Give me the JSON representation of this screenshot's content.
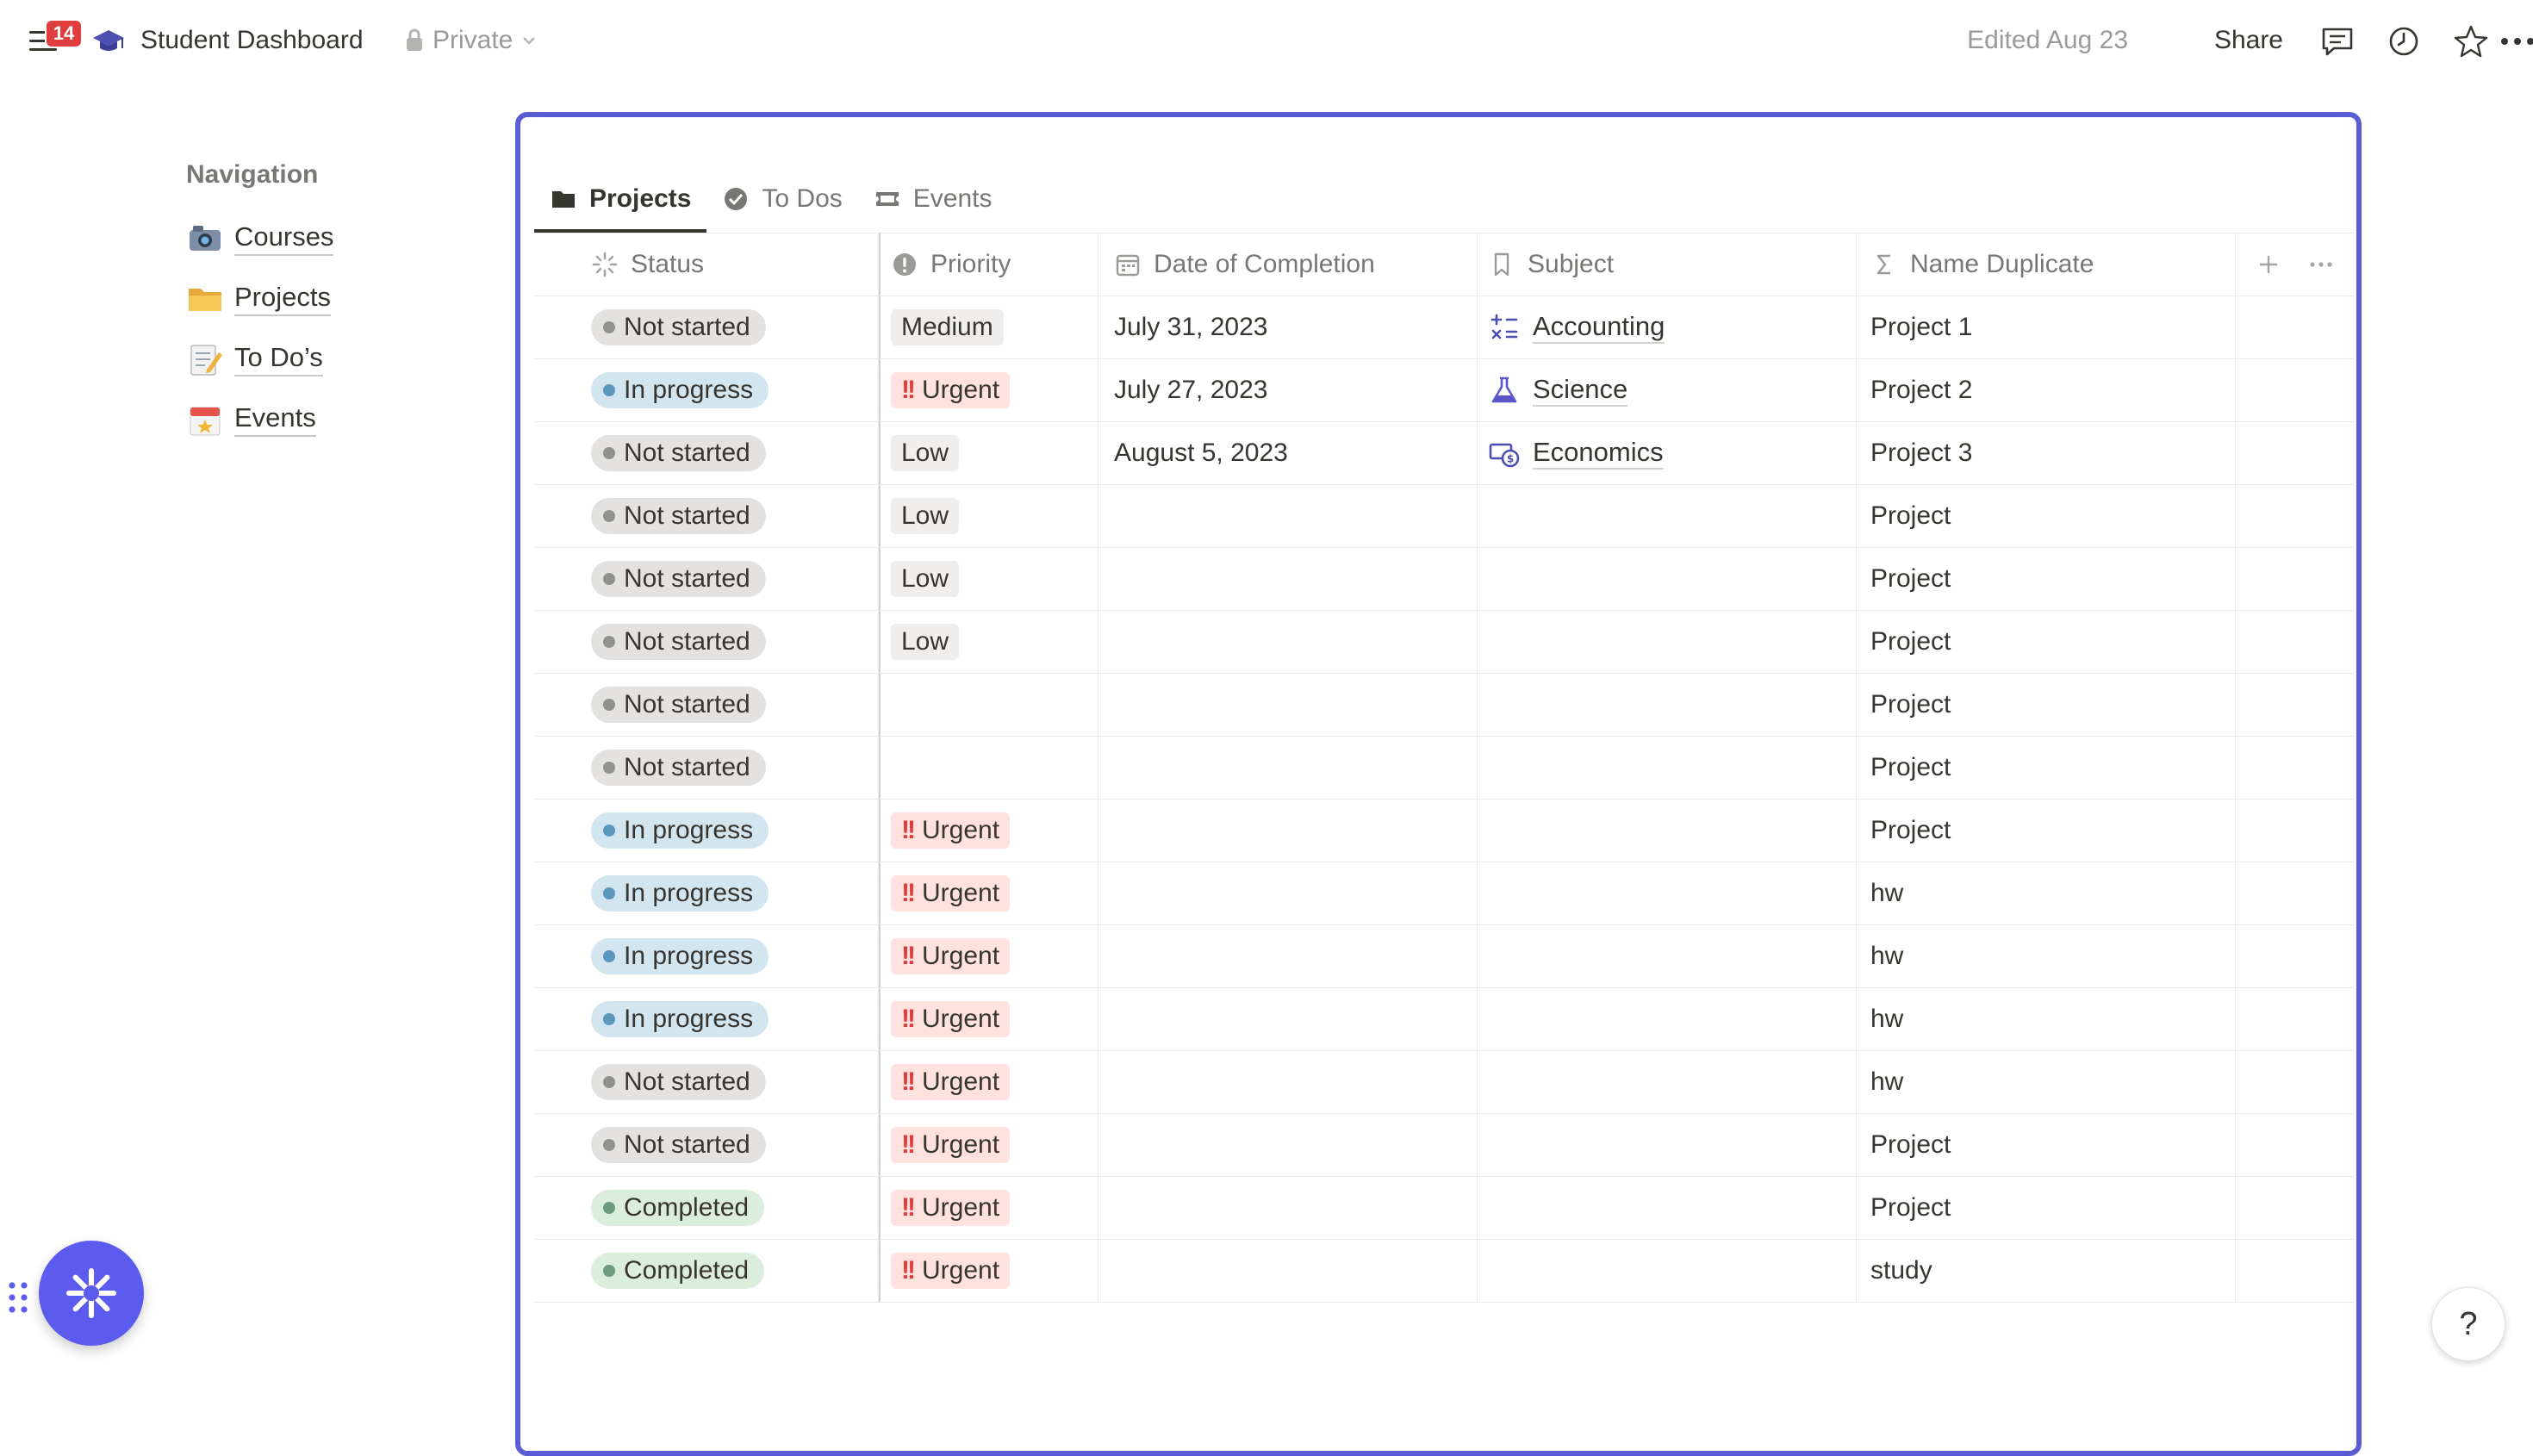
{
  "topbar": {
    "notification_count": "14",
    "title": "Student Dashboard",
    "privacy": "Private",
    "edited": "Edited Aug 23",
    "share": "Share"
  },
  "nav": {
    "heading": "Navigation",
    "items": [
      {
        "label": "Courses",
        "icon": "camera-emoji-icon"
      },
      {
        "label": "Projects",
        "icon": "folder-emoji-icon"
      },
      {
        "label": "To Do’s",
        "icon": "memo-emoji-icon"
      },
      {
        "label": "Events",
        "icon": "calendar-emoji-icon"
      }
    ]
  },
  "tabs": [
    {
      "label": "Projects",
      "icon": "folder-icon",
      "active": true
    },
    {
      "label": "To Dos",
      "icon": "check-circle-icon",
      "active": false
    },
    {
      "label": "Events",
      "icon": "ticket-icon",
      "active": false
    }
  ],
  "columns": {
    "status": "Status",
    "priority": "Priority",
    "date": "Date of Completion",
    "subject": "Subject",
    "name": "Name Duplicate"
  },
  "rows": [
    {
      "status": "Not started",
      "priority": "Medium",
      "date": "July 31, 2023",
      "subject": "Accounting",
      "name": "Project 1"
    },
    {
      "status": "In progress",
      "priority": "Urgent",
      "date": "July 27, 2023",
      "subject": "Science",
      "name": "Project 2"
    },
    {
      "status": "Not started",
      "priority": "Low",
      "date": "August 5, 2023",
      "subject": "Economics",
      "name": "Project 3"
    },
    {
      "status": "Not started",
      "priority": "Low",
      "date": "",
      "subject": "",
      "name": "Project"
    },
    {
      "status": "Not started",
      "priority": "Low",
      "date": "",
      "subject": "",
      "name": "Project"
    },
    {
      "status": "Not started",
      "priority": "Low",
      "date": "",
      "subject": "",
      "name": "Project"
    },
    {
      "status": "Not started",
      "priority": "",
      "date": "",
      "subject": "",
      "name": "Project"
    },
    {
      "status": "Not started",
      "priority": "",
      "date": "",
      "subject": "",
      "name": "Project"
    },
    {
      "status": "In progress",
      "priority": "Urgent",
      "date": "",
      "subject": "",
      "name": "Project"
    },
    {
      "status": "In progress",
      "priority": "Urgent",
      "date": "",
      "subject": "",
      "name": "hw"
    },
    {
      "status": "In progress",
      "priority": "Urgent",
      "date": "",
      "subject": "",
      "name": "hw"
    },
    {
      "status": "In progress",
      "priority": "Urgent",
      "date": "",
      "subject": "",
      "name": "hw"
    },
    {
      "status": "Not started",
      "priority": "Urgent",
      "date": "",
      "subject": "",
      "name": "hw"
    },
    {
      "status": "Not started",
      "priority": "Urgent",
      "date": "",
      "subject": "",
      "name": "Project"
    },
    {
      "status": "Completed",
      "priority": "Urgent",
      "date": "",
      "subject": "",
      "name": "Project"
    },
    {
      "status": "Completed",
      "priority": "Urgent",
      "date": "",
      "subject": "",
      "name": "study"
    }
  ],
  "help": "?",
  "colors": {
    "frame_accent": "#5b5bd6",
    "ai_button": "#5b5bf0",
    "urgent_red": "#e03e3e",
    "not_started_bg": "#e3e2e0",
    "in_progress_bg": "#d3e5ef",
    "completed_bg": "#dbeddb"
  }
}
